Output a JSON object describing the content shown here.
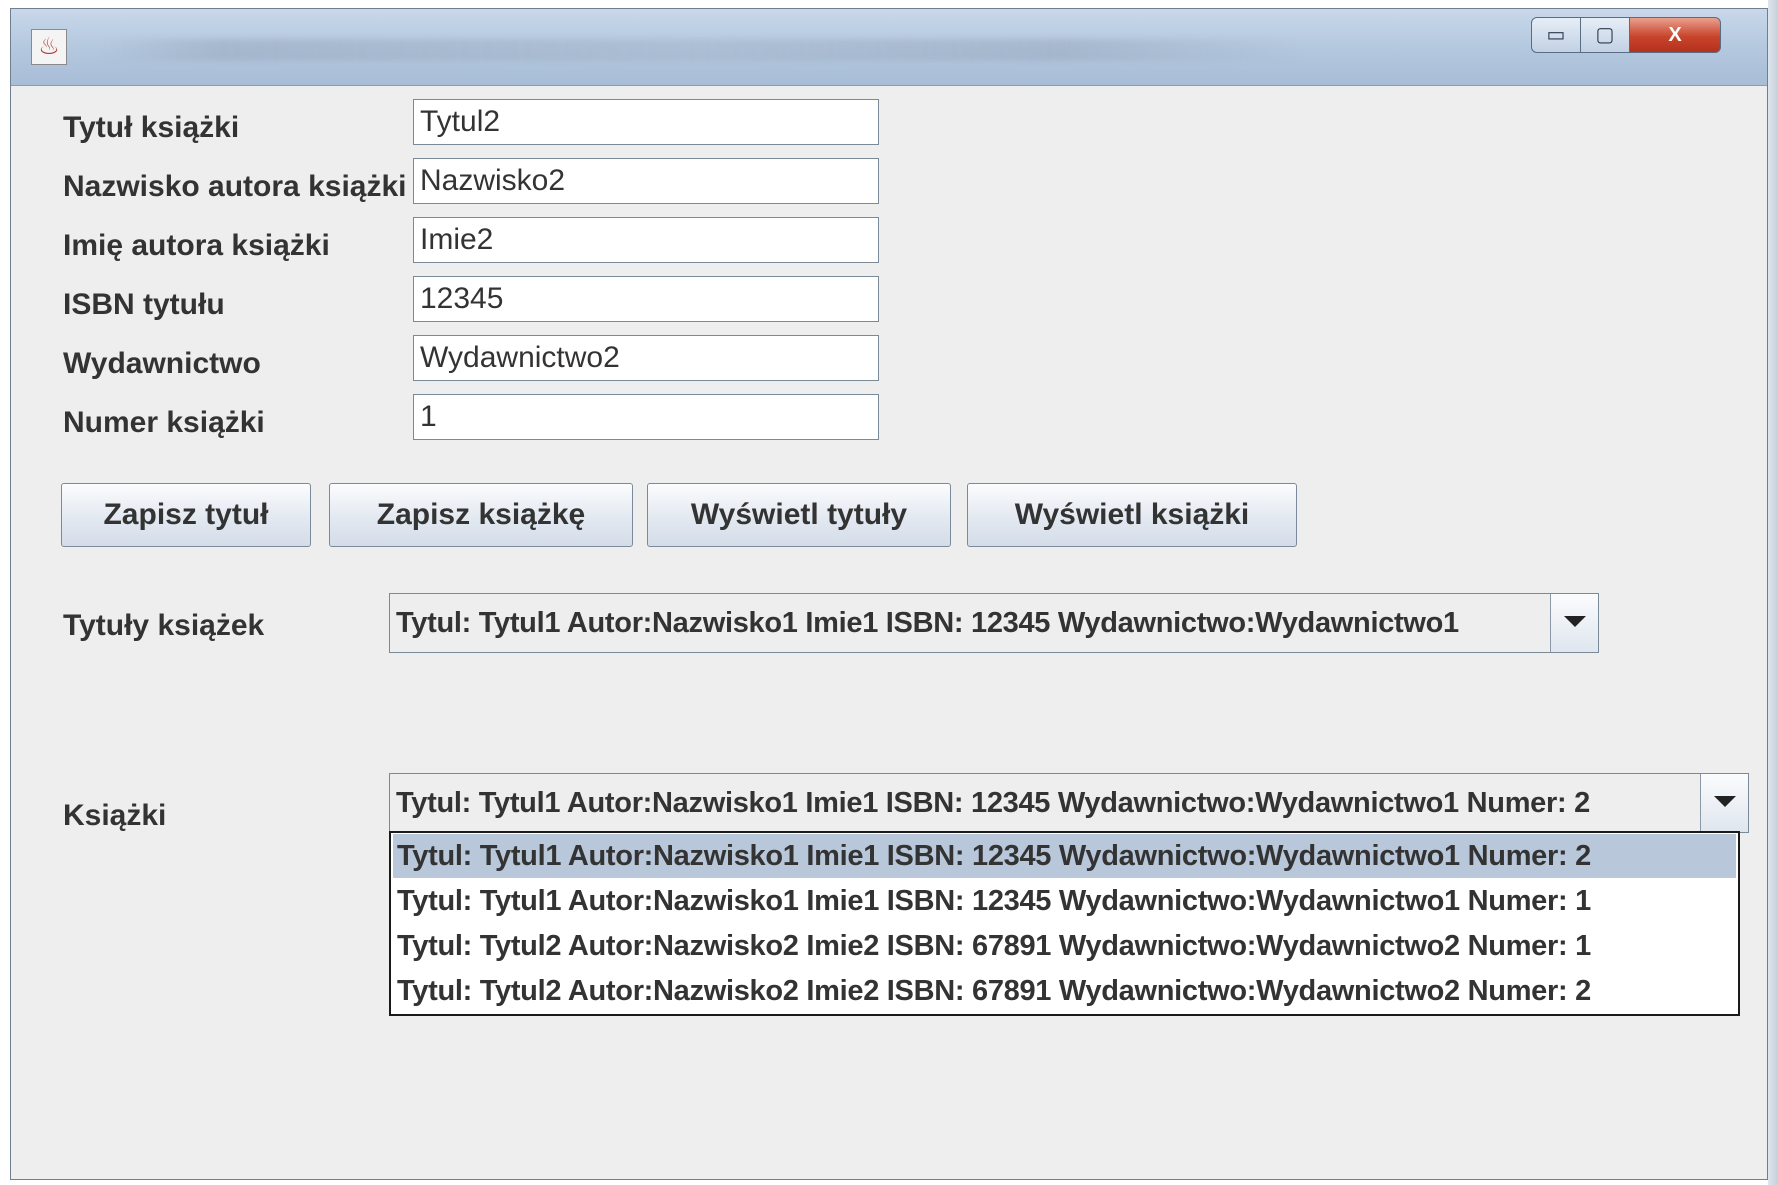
{
  "window": {
    "app_icon_glyph": "♨",
    "controls": {
      "minimize": "▭",
      "maximize": "▢",
      "close": "X"
    }
  },
  "form": {
    "title_label": "Tytuł książki",
    "title_value": "Tytul2",
    "surname_label": "Nazwisko autora książki",
    "surname_value": "Nazwisko2",
    "firstname_label": "Imię autora książki",
    "firstname_value": "Imie2",
    "isbn_label": "ISBN tytułu",
    "isbn_value": "12345",
    "publisher_label": "Wydawnictwo",
    "publisher_value": "Wydawnictwo2",
    "number_label": "Numer książki",
    "number_value": "1"
  },
  "buttons": {
    "save_title": "Zapisz tytuł",
    "save_book": "Zapisz książkę",
    "show_titles": "Wyświetl tytuły",
    "show_books": "Wyświetl książki"
  },
  "titles_combo": {
    "label": "Tytuły książek",
    "selected": "Tytul: Tytul1 Autor:Nazwisko1 Imie1 ISBN: 12345 Wydawnictwo:Wydawnictwo1"
  },
  "books_combo": {
    "label": "Książki",
    "selected": "Tytul: Tytul1 Autor:Nazwisko1 Imie1 ISBN: 12345 Wydawnictwo:Wydawnictwo1 Numer: 2",
    "options": [
      "Tytul: Tytul1 Autor:Nazwisko1 Imie1 ISBN: 12345 Wydawnictwo:Wydawnictwo1 Numer: 2",
      "Tytul: Tytul1 Autor:Nazwisko1 Imie1 ISBN: 12345 Wydawnictwo:Wydawnictwo1 Numer: 1",
      "Tytul: Tytul2 Autor:Nazwisko2 Imie2 ISBN: 67891 Wydawnictwo:Wydawnictwo2 Numer: 1",
      "Tytul: Tytul2 Autor:Nazwisko2 Imie2 ISBN: 67891 Wydawnictwo:Wydawnictwo2 Numer: 2"
    ],
    "highlighted_index": 0
  },
  "colors": {
    "window_bg": "#eeeeee",
    "selection": "#b8c7da",
    "close_button": "#c8442c"
  }
}
